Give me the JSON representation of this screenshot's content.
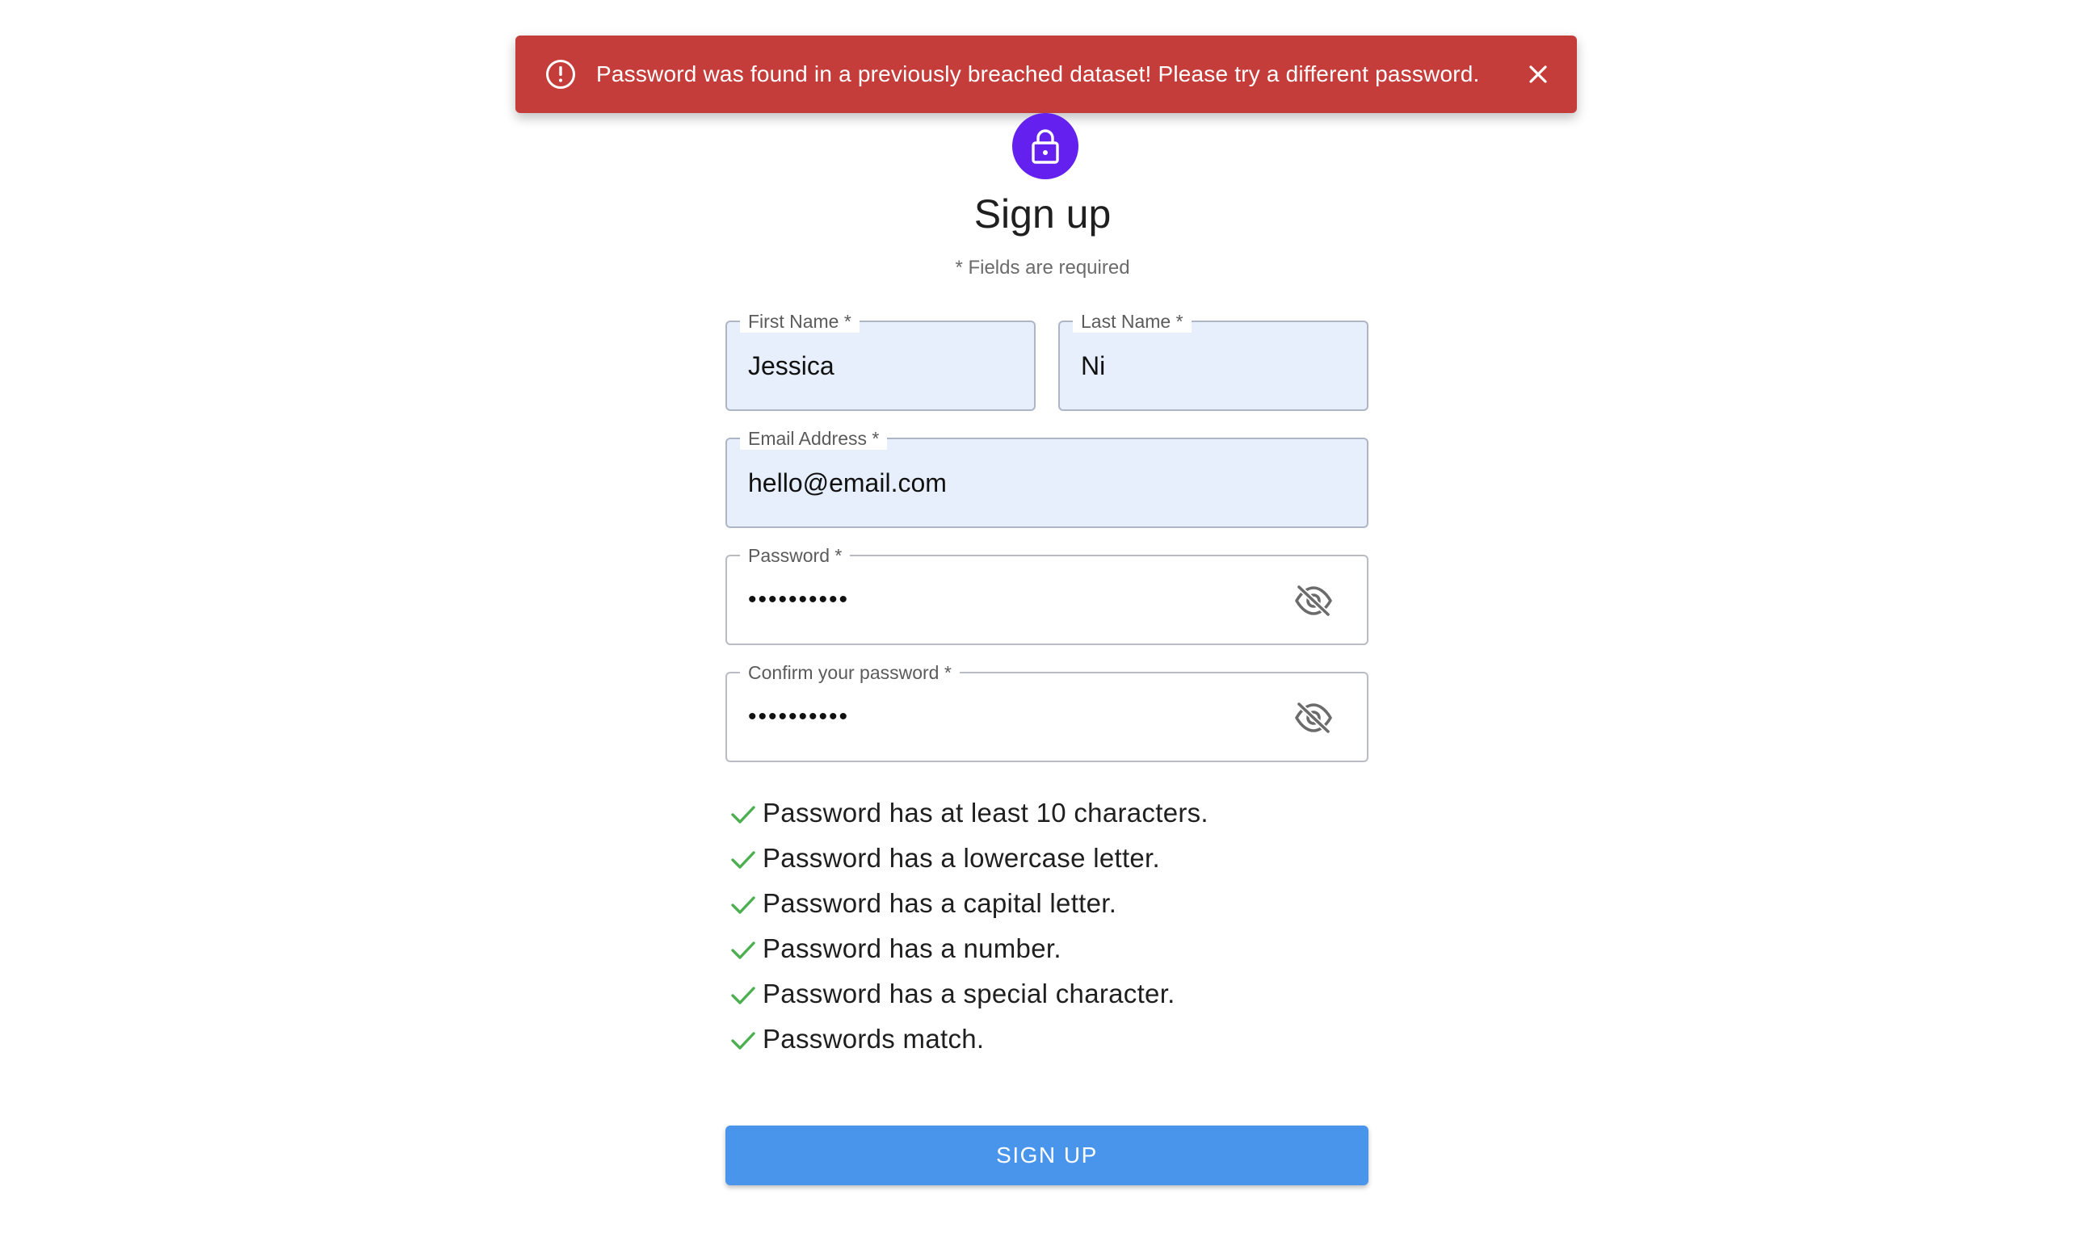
{
  "alert": {
    "message": "Password was found in a previously breached dataset! Please try a different password.",
    "icon": "error-outline-icon",
    "close_icon": "close-icon",
    "color": "#c53d3a"
  },
  "avatar": {
    "icon": "lock-icon",
    "color": "#6320ee"
  },
  "form": {
    "title": "Sign up",
    "required_note": "* Fields are required",
    "first_name": {
      "label": "First Name *",
      "value": "Jessica"
    },
    "last_name": {
      "label": "Last Name *",
      "value": "Ni"
    },
    "email": {
      "label": "Email Address *",
      "value": "hello@email.com"
    },
    "password": {
      "label": "Password *",
      "value": "••••••••••",
      "toggle_icon": "eye-off-icon"
    },
    "confirm_password": {
      "label": "Confirm your password *",
      "value": "••••••••••",
      "toggle_icon": "eye-off-icon"
    }
  },
  "requirements": [
    {
      "text": "Password has at least 10 characters.",
      "met": true
    },
    {
      "text": "Password has a lowercase letter.",
      "met": true
    },
    {
      "text": "Password has a capital letter.",
      "met": true
    },
    {
      "text": "Password has a number.",
      "met": true
    },
    {
      "text": "Password has a special character.",
      "met": true
    },
    {
      "text": "Passwords match.",
      "met": true
    }
  ],
  "check_color": "#4caf50",
  "submit": {
    "label": "SIGN UP",
    "color": "#4a95ec"
  }
}
